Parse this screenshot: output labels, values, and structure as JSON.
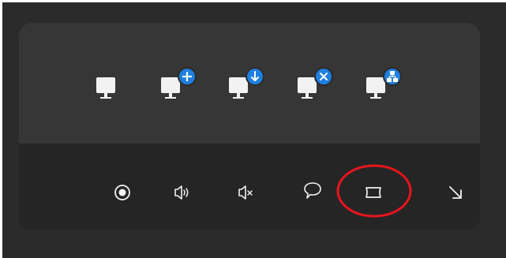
{
  "colors": {
    "background": "#2b2b2b",
    "panel_top": "#363636",
    "panel_bottom": "#252525",
    "icon": "#f2f2f2",
    "badge": "#1f7fe0",
    "highlight": "#e8141c"
  },
  "network_icons": [
    {
      "icon": "monitor-icon"
    },
    {
      "icon": "monitor-add-icon"
    },
    {
      "icon": "monitor-download-icon"
    },
    {
      "icon": "monitor-remove-icon"
    },
    {
      "icon": "monitor-network-icon"
    }
  ],
  "toolbar": [
    {
      "icon": "record-icon"
    },
    {
      "icon": "volume-icon"
    },
    {
      "icon": "mute-icon"
    },
    {
      "icon": "chat-icon"
    },
    {
      "icon": "aspect-ratio-icon",
      "highlighted": true
    },
    {
      "icon": "collapse-arrow-icon"
    }
  ]
}
